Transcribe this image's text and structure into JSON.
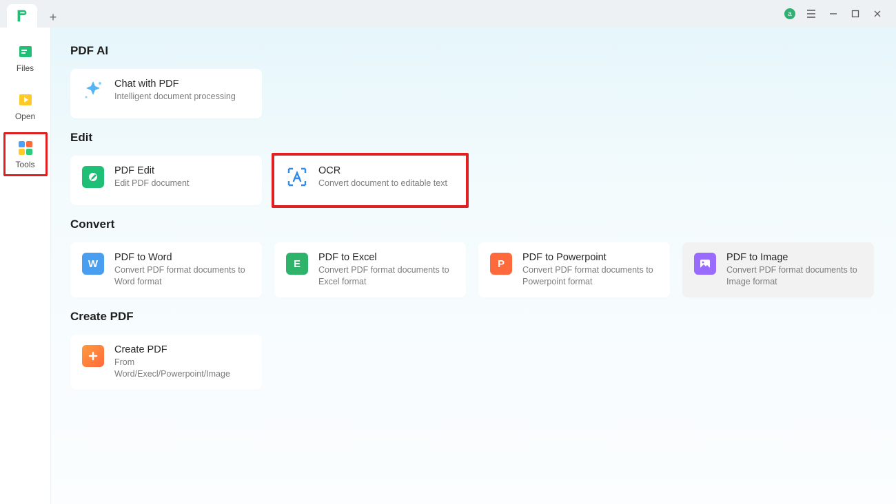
{
  "titlebar": {
    "avatar_initial": "a"
  },
  "sidebar": {
    "items": [
      {
        "id": "files",
        "label": "Files"
      },
      {
        "id": "open",
        "label": "Open"
      },
      {
        "id": "tools",
        "label": "Tools"
      }
    ]
  },
  "sections": {
    "pdf_ai": {
      "title": "PDF AI",
      "cards": [
        {
          "id": "chat-pdf",
          "title": "Chat with PDF",
          "sub": "Intelligent document processing"
        }
      ]
    },
    "edit": {
      "title": "Edit",
      "cards": [
        {
          "id": "pdf-edit",
          "title": "PDF Edit",
          "sub": "Edit PDF document"
        },
        {
          "id": "ocr",
          "title": "OCR",
          "sub": "Convert document to editable text"
        }
      ]
    },
    "convert": {
      "title": "Convert",
      "cards": [
        {
          "id": "to-word",
          "title": "PDF to Word",
          "sub": "Convert PDF format documents to Word format"
        },
        {
          "id": "to-excel",
          "title": "PDF to Excel",
          "sub": "Convert PDF format documents to Excel format"
        },
        {
          "id": "to-ppt",
          "title": "PDF to Powerpoint",
          "sub": "Convert PDF format documents to Powerpoint format"
        },
        {
          "id": "to-image",
          "title": "PDF to Image",
          "sub": "Convert PDF format documents to Image format"
        }
      ]
    },
    "create": {
      "title": "Create PDF",
      "cards": [
        {
          "id": "create-pdf",
          "title": "Create PDF",
          "sub": "From Word/Execl/Powerpoint/Image"
        }
      ]
    }
  }
}
